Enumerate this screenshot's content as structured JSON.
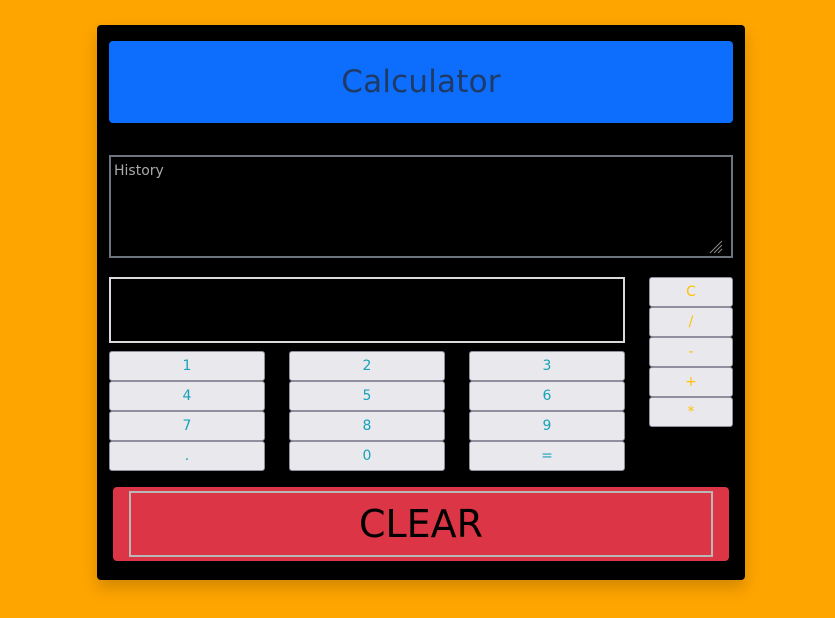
{
  "header": {
    "title": "Calculator"
  },
  "history": {
    "placeholder": "History",
    "value": ""
  },
  "display": {
    "value": ""
  },
  "keypad": {
    "rows": [
      [
        "1",
        "2",
        "3"
      ],
      [
        "4",
        "5",
        "6"
      ],
      [
        "7",
        "8",
        "9"
      ],
      [
        ".",
        "0",
        "="
      ]
    ]
  },
  "operators": [
    "C",
    "/",
    "-",
    "+",
    "*"
  ],
  "clear": {
    "label": "CLEAR"
  },
  "colors": {
    "background": "#FFA500",
    "panel": "#000000",
    "header": "#0D6EFD",
    "header_text": "#1F3A66",
    "number_text": "#17A2B8",
    "operator_text": "#FFC107",
    "clear": "#DC3545"
  }
}
